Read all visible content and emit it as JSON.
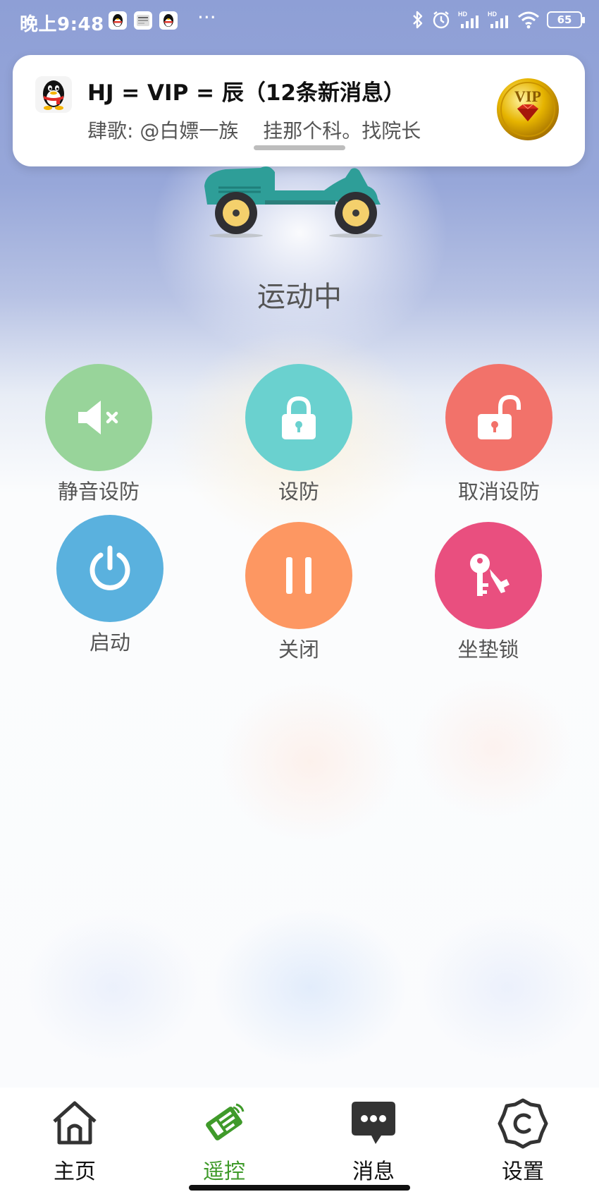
{
  "status_bar": {
    "time": "晚上9:48",
    "more": "···",
    "battery": "65"
  },
  "notification": {
    "title": "HJ = VIP = 辰（12条新消息）",
    "sender": "肆歌:",
    "mention": "@白嫖一族",
    "message": "挂那个科。找院长",
    "badge_text": "VIP"
  },
  "vehicle": {
    "state": "运动中"
  },
  "controls": [
    {
      "label": "静音设防",
      "color": "#98d49a",
      "icon": "mute-icon"
    },
    {
      "label": "设防",
      "color": "#6ad1cf",
      "icon": "lock-icon"
    },
    {
      "label": "取消设防",
      "color": "#f2726a",
      "icon": "unlock-icon"
    },
    {
      "label": "启动",
      "color": "#5ab1de",
      "icon": "power-icon"
    },
    {
      "label": "关闭",
      "color": "#fd9762",
      "icon": "pause-icon"
    },
    {
      "label": "坐垫锁",
      "color": "#e94f7f",
      "icon": "keys-icon"
    }
  ],
  "nav": [
    {
      "label": "主页",
      "icon": "home-icon",
      "active": false
    },
    {
      "label": "遥控",
      "icon": "remote-icon",
      "active": true
    },
    {
      "label": "消息",
      "icon": "message-icon",
      "active": false
    },
    {
      "label": "设置",
      "icon": "settings-icon",
      "active": false
    }
  ],
  "colors": {
    "active_nav": "#3f9a2a",
    "scooter_body": "#2e9e98"
  }
}
